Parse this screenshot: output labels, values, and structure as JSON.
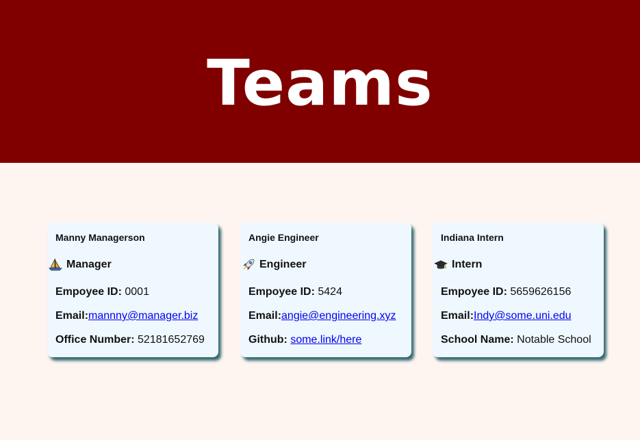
{
  "header": {
    "title": "Teams",
    "background_color": "#800000"
  },
  "cards": [
    {
      "name": "Manny Managerson",
      "role": "Manager",
      "role_icon": "sailboat-icon",
      "id_label": "Empoyee ID:",
      "id_value": "0001",
      "email_label": "Email:",
      "email_value": "mannny@manager.biz",
      "extra_label": "Office Number:",
      "extra_value": "52181652769"
    },
    {
      "name": "Angie Engineer",
      "role": "Engineer",
      "role_icon": "rocket-icon",
      "id_label": "Empoyee ID:",
      "id_value": "5424",
      "email_label": "Email:",
      "email_value": "angie@engineering.xyz",
      "extra_label": "Github:",
      "extra_value": "some.link/here"
    },
    {
      "name": "Indiana Intern",
      "role": "Intern",
      "role_icon": "graduation-cap-icon",
      "id_label": "Empoyee ID:",
      "id_value": "5659626156",
      "email_label": "Email:",
      "email_value": "Indy@some.uni.edu",
      "extra_label": "School Name:",
      "extra_value": "Notable School"
    }
  ],
  "colors": {
    "page_background": "#fff5f0",
    "card_background": "#eff8ff",
    "link": "#0000ee"
  }
}
